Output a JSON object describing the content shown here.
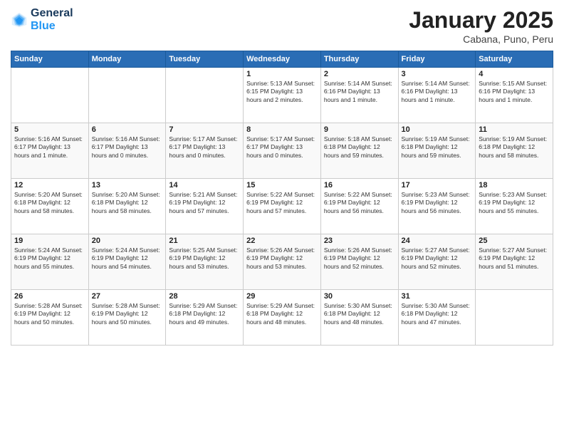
{
  "header": {
    "logo_line1": "General",
    "logo_line2": "Blue",
    "month": "January 2025",
    "location": "Cabana, Puno, Peru"
  },
  "weekdays": [
    "Sunday",
    "Monday",
    "Tuesday",
    "Wednesday",
    "Thursday",
    "Friday",
    "Saturday"
  ],
  "weeks": [
    [
      {
        "day": "",
        "info": ""
      },
      {
        "day": "",
        "info": ""
      },
      {
        "day": "",
        "info": ""
      },
      {
        "day": "1",
        "info": "Sunrise: 5:13 AM\nSunset: 6:15 PM\nDaylight: 13 hours\nand 2 minutes."
      },
      {
        "day": "2",
        "info": "Sunrise: 5:14 AM\nSunset: 6:16 PM\nDaylight: 13 hours\nand 1 minute."
      },
      {
        "day": "3",
        "info": "Sunrise: 5:14 AM\nSunset: 6:16 PM\nDaylight: 13 hours\nand 1 minute."
      },
      {
        "day": "4",
        "info": "Sunrise: 5:15 AM\nSunset: 6:16 PM\nDaylight: 13 hours\nand 1 minute."
      }
    ],
    [
      {
        "day": "5",
        "info": "Sunrise: 5:16 AM\nSunset: 6:17 PM\nDaylight: 13 hours\nand 1 minute."
      },
      {
        "day": "6",
        "info": "Sunrise: 5:16 AM\nSunset: 6:17 PM\nDaylight: 13 hours\nand 0 minutes."
      },
      {
        "day": "7",
        "info": "Sunrise: 5:17 AM\nSunset: 6:17 PM\nDaylight: 13 hours\nand 0 minutes."
      },
      {
        "day": "8",
        "info": "Sunrise: 5:17 AM\nSunset: 6:17 PM\nDaylight: 13 hours\nand 0 minutes."
      },
      {
        "day": "9",
        "info": "Sunrise: 5:18 AM\nSunset: 6:18 PM\nDaylight: 12 hours\nand 59 minutes."
      },
      {
        "day": "10",
        "info": "Sunrise: 5:19 AM\nSunset: 6:18 PM\nDaylight: 12 hours\nand 59 minutes."
      },
      {
        "day": "11",
        "info": "Sunrise: 5:19 AM\nSunset: 6:18 PM\nDaylight: 12 hours\nand 58 minutes."
      }
    ],
    [
      {
        "day": "12",
        "info": "Sunrise: 5:20 AM\nSunset: 6:18 PM\nDaylight: 12 hours\nand 58 minutes."
      },
      {
        "day": "13",
        "info": "Sunrise: 5:20 AM\nSunset: 6:18 PM\nDaylight: 12 hours\nand 58 minutes."
      },
      {
        "day": "14",
        "info": "Sunrise: 5:21 AM\nSunset: 6:19 PM\nDaylight: 12 hours\nand 57 minutes."
      },
      {
        "day": "15",
        "info": "Sunrise: 5:22 AM\nSunset: 6:19 PM\nDaylight: 12 hours\nand 57 minutes."
      },
      {
        "day": "16",
        "info": "Sunrise: 5:22 AM\nSunset: 6:19 PM\nDaylight: 12 hours\nand 56 minutes."
      },
      {
        "day": "17",
        "info": "Sunrise: 5:23 AM\nSunset: 6:19 PM\nDaylight: 12 hours\nand 56 minutes."
      },
      {
        "day": "18",
        "info": "Sunrise: 5:23 AM\nSunset: 6:19 PM\nDaylight: 12 hours\nand 55 minutes."
      }
    ],
    [
      {
        "day": "19",
        "info": "Sunrise: 5:24 AM\nSunset: 6:19 PM\nDaylight: 12 hours\nand 55 minutes."
      },
      {
        "day": "20",
        "info": "Sunrise: 5:24 AM\nSunset: 6:19 PM\nDaylight: 12 hours\nand 54 minutes."
      },
      {
        "day": "21",
        "info": "Sunrise: 5:25 AM\nSunset: 6:19 PM\nDaylight: 12 hours\nand 53 minutes."
      },
      {
        "day": "22",
        "info": "Sunrise: 5:26 AM\nSunset: 6:19 PM\nDaylight: 12 hours\nand 53 minutes."
      },
      {
        "day": "23",
        "info": "Sunrise: 5:26 AM\nSunset: 6:19 PM\nDaylight: 12 hours\nand 52 minutes."
      },
      {
        "day": "24",
        "info": "Sunrise: 5:27 AM\nSunset: 6:19 PM\nDaylight: 12 hours\nand 52 minutes."
      },
      {
        "day": "25",
        "info": "Sunrise: 5:27 AM\nSunset: 6:19 PM\nDaylight: 12 hours\nand 51 minutes."
      }
    ],
    [
      {
        "day": "26",
        "info": "Sunrise: 5:28 AM\nSunset: 6:19 PM\nDaylight: 12 hours\nand 50 minutes."
      },
      {
        "day": "27",
        "info": "Sunrise: 5:28 AM\nSunset: 6:19 PM\nDaylight: 12 hours\nand 50 minutes."
      },
      {
        "day": "28",
        "info": "Sunrise: 5:29 AM\nSunset: 6:18 PM\nDaylight: 12 hours\nand 49 minutes."
      },
      {
        "day": "29",
        "info": "Sunrise: 5:29 AM\nSunset: 6:18 PM\nDaylight: 12 hours\nand 48 minutes."
      },
      {
        "day": "30",
        "info": "Sunrise: 5:30 AM\nSunset: 6:18 PM\nDaylight: 12 hours\nand 48 minutes."
      },
      {
        "day": "31",
        "info": "Sunrise: 5:30 AM\nSunset: 6:18 PM\nDaylight: 12 hours\nand 47 minutes."
      },
      {
        "day": "",
        "info": ""
      }
    ]
  ]
}
